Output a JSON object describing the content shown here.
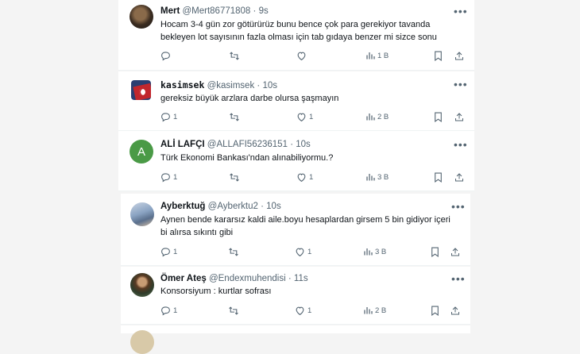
{
  "tweets": [
    {
      "name": "Mert",
      "handle": "@Mert86771808",
      "sep": "·",
      "time": "9s",
      "lines": [
        "Hocam 3-4 gün zor götürürüz bunu bence çok para gerekiyor tavanda",
        "bekleyen lot sayısının fazla olması için tab gıdaya benzer mi sizce sonu"
      ],
      "replies": "",
      "retweets": "",
      "likes": "",
      "views": "1 B"
    },
    {
      "name": "kasimsek",
      "handle": "@kasimsek",
      "sep": "·",
      "time": "10s",
      "lines": [
        "gereksiz büyük arzlara darbe olursa şaşmayın"
      ],
      "replies": "1",
      "retweets": "",
      "likes": "1",
      "views": "2 B"
    },
    {
      "name": "ALİ LAFÇI",
      "handle": "@ALLAFI56236151",
      "sep": "·",
      "time": "10s",
      "avatar_letter": "A",
      "lines": [
        "Türk Ekonomi Bankası'ndan alınabiliyormu.?"
      ],
      "replies": "1",
      "retweets": "",
      "likes": "1",
      "views": "3 B"
    },
    {
      "name": "Ayberktuğ",
      "handle": "@Ayberktu2",
      "sep": "·",
      "time": "10s",
      "lines": [
        "Aynen bende kararsız kaldi aile.boyu hesaplardan girsem 5 bin gidiyor içeri",
        "bi alırsa sıkıntı gibi"
      ],
      "replies": "1",
      "retweets": "",
      "likes": "1",
      "views": "3 B"
    },
    {
      "name": "Ömer Ateş",
      "handle": "@Endexmuhendisi",
      "sep": "·",
      "time": "11s",
      "lines": [
        "Konsorsiyum : kurtlar sofrası"
      ],
      "replies": "1",
      "retweets": "",
      "likes": "1",
      "views": "2 B"
    }
  ],
  "icons": {
    "reply": "reply-icon",
    "retweet": "retweet-icon",
    "like": "like-icon",
    "views": "views-icon",
    "bookmark": "bookmark-icon",
    "share": "share-icon",
    "more": "more-icon"
  },
  "colors": {
    "text": "#0f1419",
    "muted": "#536471",
    "background": "#f4f4f4",
    "card": "#ffffff"
  }
}
